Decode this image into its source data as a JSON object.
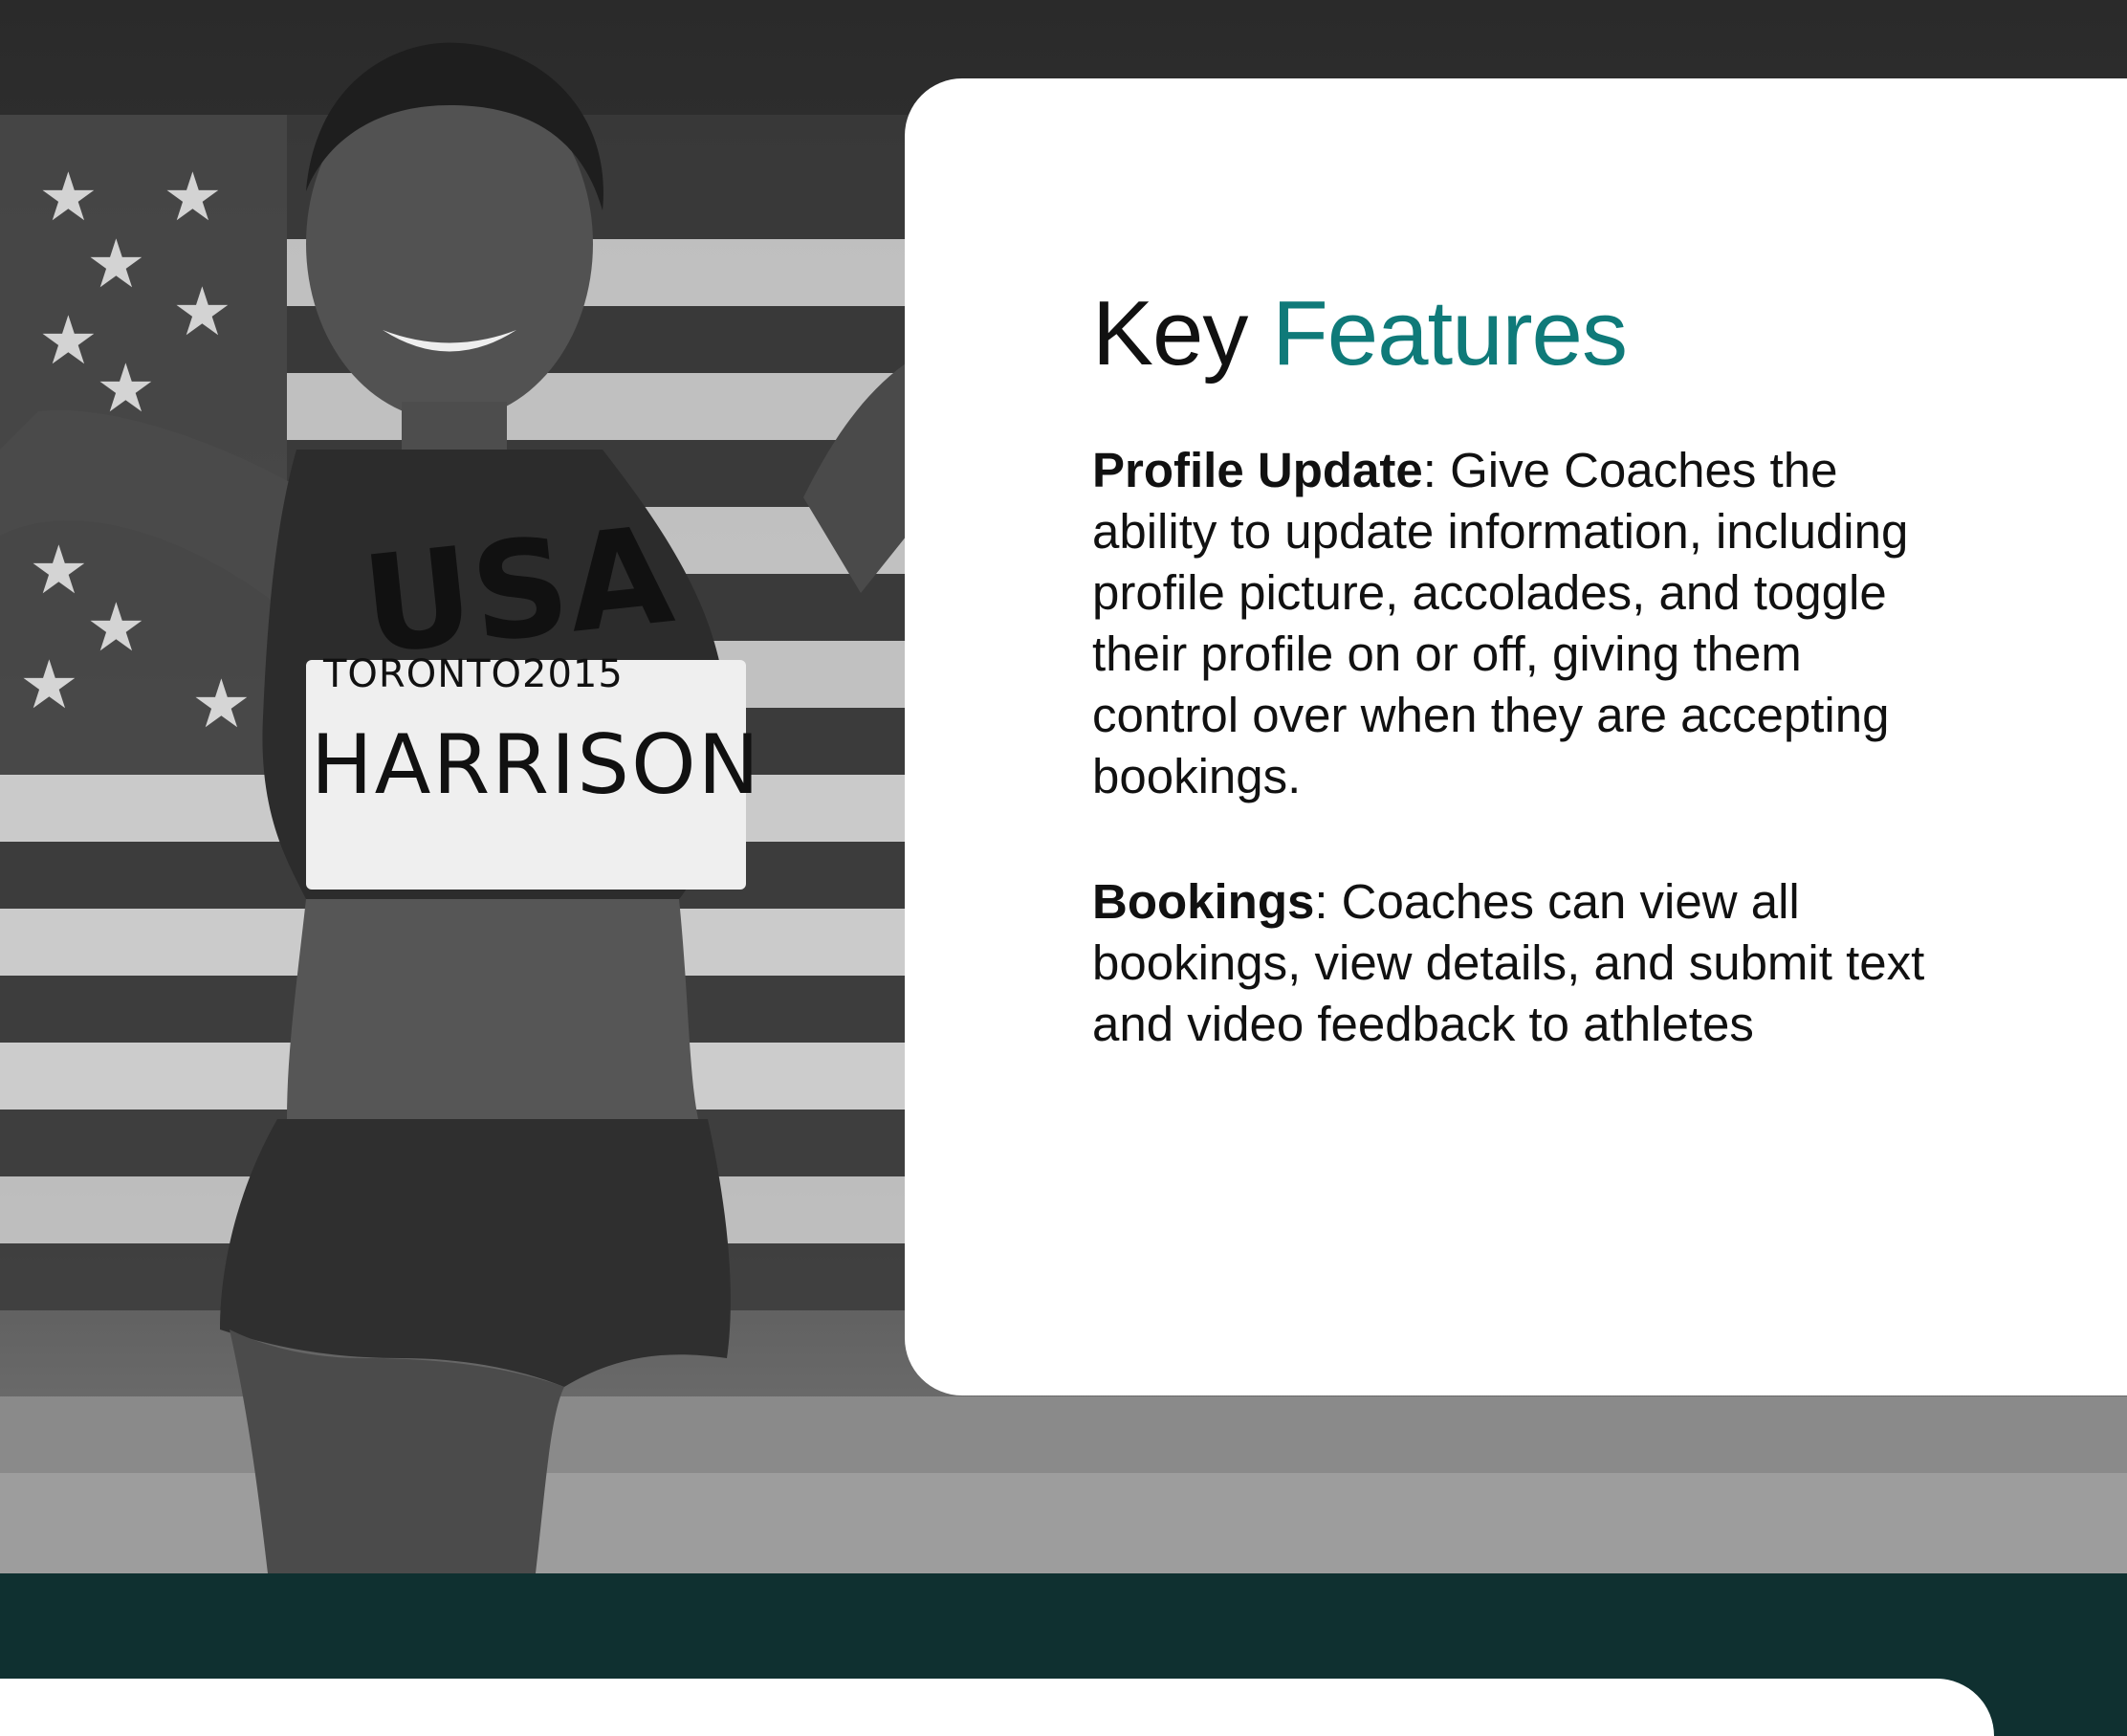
{
  "photo": {
    "description_icon": "athlete-photo",
    "bib_top": "TORONTO2015",
    "bib_name": "HARRISON",
    "jersey_text": "USA"
  },
  "features_card": {
    "heading_plain": "Key",
    "heading_accent": "Features",
    "accent_color": "#0f7a79",
    "items": [
      {
        "title": "Profile Update",
        "text": ": Give Coaches the ability to update information, including profile picture, accolades, and toggle their profile on or off, giving them control over when they are accepting bookings."
      },
      {
        "title": "Bookings",
        "text": ": Coaches can view all bookings, view details, and submit text and video feedback to athletes"
      }
    ]
  },
  "colors": {
    "band": "#0f3030",
    "card": "#ffffff"
  }
}
